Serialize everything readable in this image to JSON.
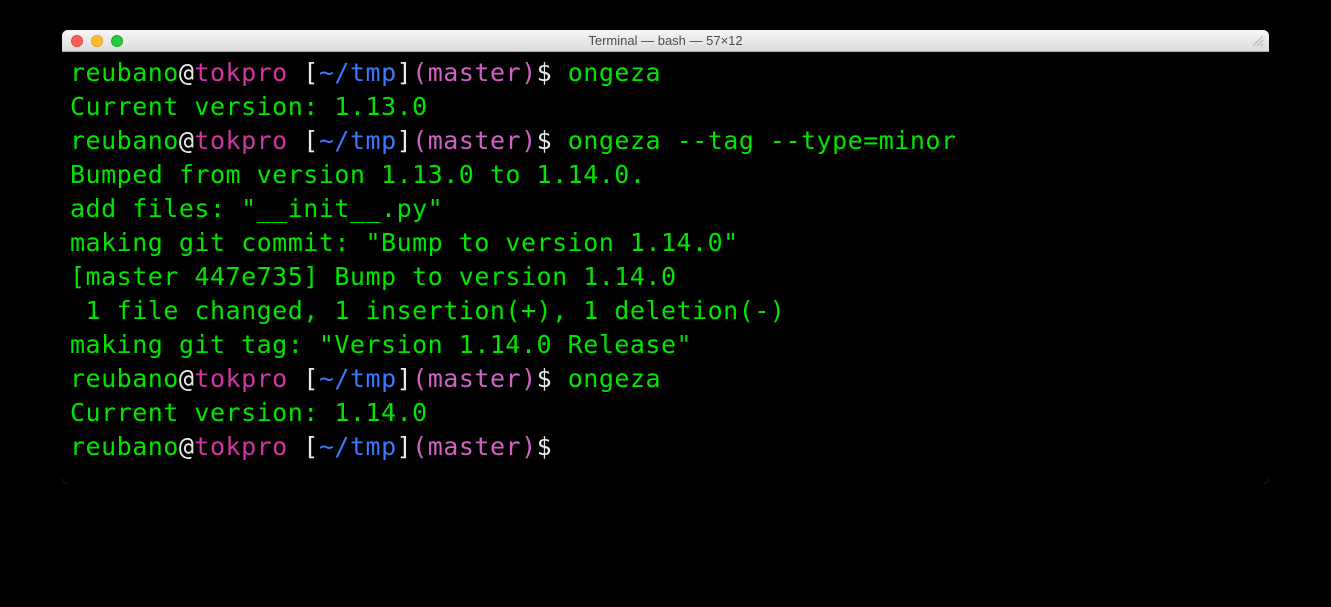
{
  "window": {
    "title": "Terminal — bash — 57×12"
  },
  "prompt": {
    "user": "reubano",
    "at": "@",
    "host": "tokpro",
    "space": " ",
    "path_l": "[",
    "path": "~/tmp",
    "path_r": "]",
    "branch_l": "(",
    "branch": "master",
    "branch_r": ")",
    "symbol": "$ "
  },
  "lines": {
    "cmd1": "ongeza",
    "out1": "Current version: 1.13.0",
    "cmd2": "ongeza --tag --type=minor",
    "out2a": "Bumped from version 1.13.0 to 1.14.0.",
    "out2b": "add files: \"__init__.py\"",
    "out2c": "making git commit: \"Bump to version 1.14.0\"",
    "out2d": "[master 447e735] Bump to version 1.14.0",
    "out2e": " 1 file changed, 1 insertion(+), 1 deletion(-)",
    "out2f": "making git tag: \"Version 1.14.0 Release\"",
    "cmd3": "ongeza",
    "out3": "Current version: 1.14.0",
    "cmd4": ""
  }
}
